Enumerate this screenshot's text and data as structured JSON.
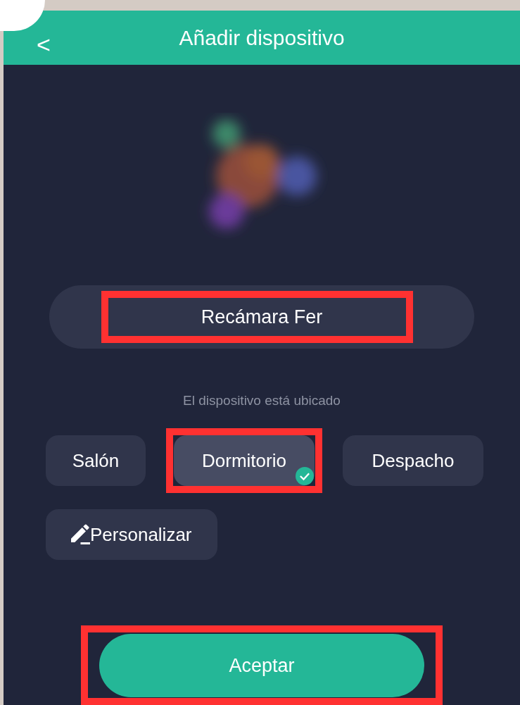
{
  "header": {
    "back": "<",
    "title": "Añadir dispositivo"
  },
  "name_field": {
    "value": "Recámara Fer",
    "highlighted": true
  },
  "location_label": "El dispositivo está ubicado",
  "rooms": [
    {
      "label": "Salón",
      "selected": false,
      "highlighted": false,
      "kind": "room"
    },
    {
      "label": "Dormitorio",
      "selected": true,
      "highlighted": true,
      "kind": "room"
    },
    {
      "label": "Despacho",
      "selected": false,
      "highlighted": false,
      "kind": "room"
    },
    {
      "label": "Personalizar",
      "selected": false,
      "highlighted": false,
      "kind": "custom"
    }
  ],
  "accept_button": {
    "label": "Aceptar",
    "highlighted": true
  }
}
